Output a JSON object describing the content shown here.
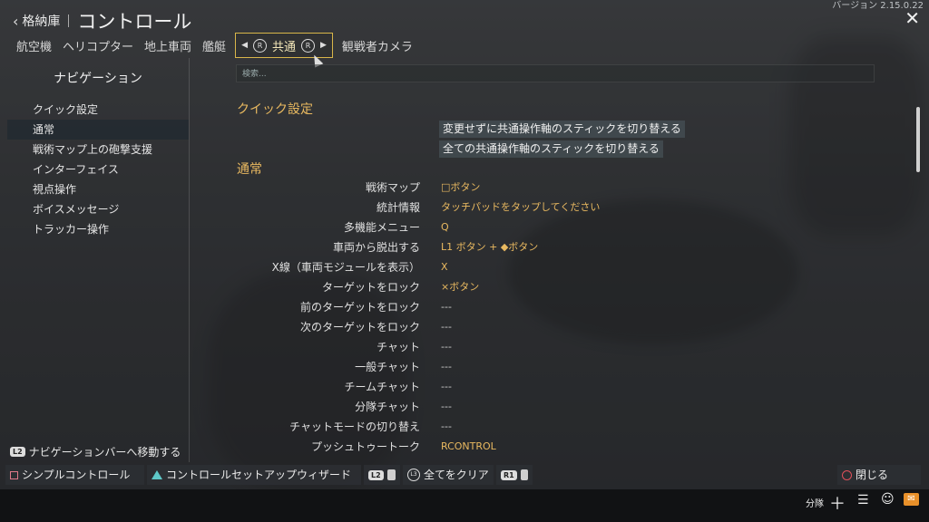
{
  "version": "バージョン 2.15.0.22",
  "header": {
    "back_label": "格納庫",
    "title": "コントロール"
  },
  "tabs": [
    "航空機",
    "ヘリコプター",
    "地上車両",
    "艦艇"
  ],
  "active_tab": "共通",
  "tab_after": "観戦者カメラ",
  "sidebar": {
    "title": "ナビゲーション",
    "items": [
      "クイック設定",
      "通常",
      "戦術マップ上の砲撃支援",
      "インターフェイス",
      "視点操作",
      "ボイスメッセージ",
      "トラッカー操作"
    ],
    "active_index": 1
  },
  "search": {
    "placeholder": "検索..."
  },
  "quick": {
    "heading": "クイック設定",
    "buttons": [
      "変更せずに共通操作軸のスティックを切り替える",
      "全ての共通操作軸のスティックを切り替える"
    ]
  },
  "general": {
    "heading": "通常",
    "rows": [
      {
        "label": "戦術マップ",
        "value": "□ボタン"
      },
      {
        "label": "統計情報",
        "value": "タッチパッドをタップしてください"
      },
      {
        "label": "多機能メニュー",
        "value": "Q"
      },
      {
        "label": "車両から脱出する",
        "value": "L1 ボタン + ◆ボタン"
      },
      {
        "label": "X線（車両モジュールを表示）",
        "value": "X"
      },
      {
        "label": "ターゲットをロック",
        "value": "×ボタン"
      },
      {
        "label": "前のターゲットをロック",
        "value": "---"
      },
      {
        "label": "次のターゲットをロック",
        "value": "---"
      },
      {
        "label": "チャット",
        "value": "---"
      },
      {
        "label": "一般チャット",
        "value": "---"
      },
      {
        "label": "チームチャット",
        "value": "---"
      },
      {
        "label": "分隊チャット",
        "value": "---"
      },
      {
        "label": "チャットモードの切り替え",
        "value": "---"
      },
      {
        "label": "プッシュトゥートーク",
        "value": "RCONTROL"
      }
    ]
  },
  "nav_hint": {
    "badge": "L2",
    "text": "ナビゲーションバーへ移動する"
  },
  "bottom": {
    "simple": "シンプルコントロール",
    "wizard": "コントロールセットアップウィザード",
    "l2_badge": "L2",
    "clear_badge": "L3",
    "clear": "全てをクリア",
    "r1_badge": "R1",
    "close": "閉じる"
  },
  "taskbar": {
    "squad": "分隊"
  },
  "colors": {
    "accent": "#e9b960",
    "tab_border": "#d8b64a",
    "mail": "#e8902a"
  }
}
